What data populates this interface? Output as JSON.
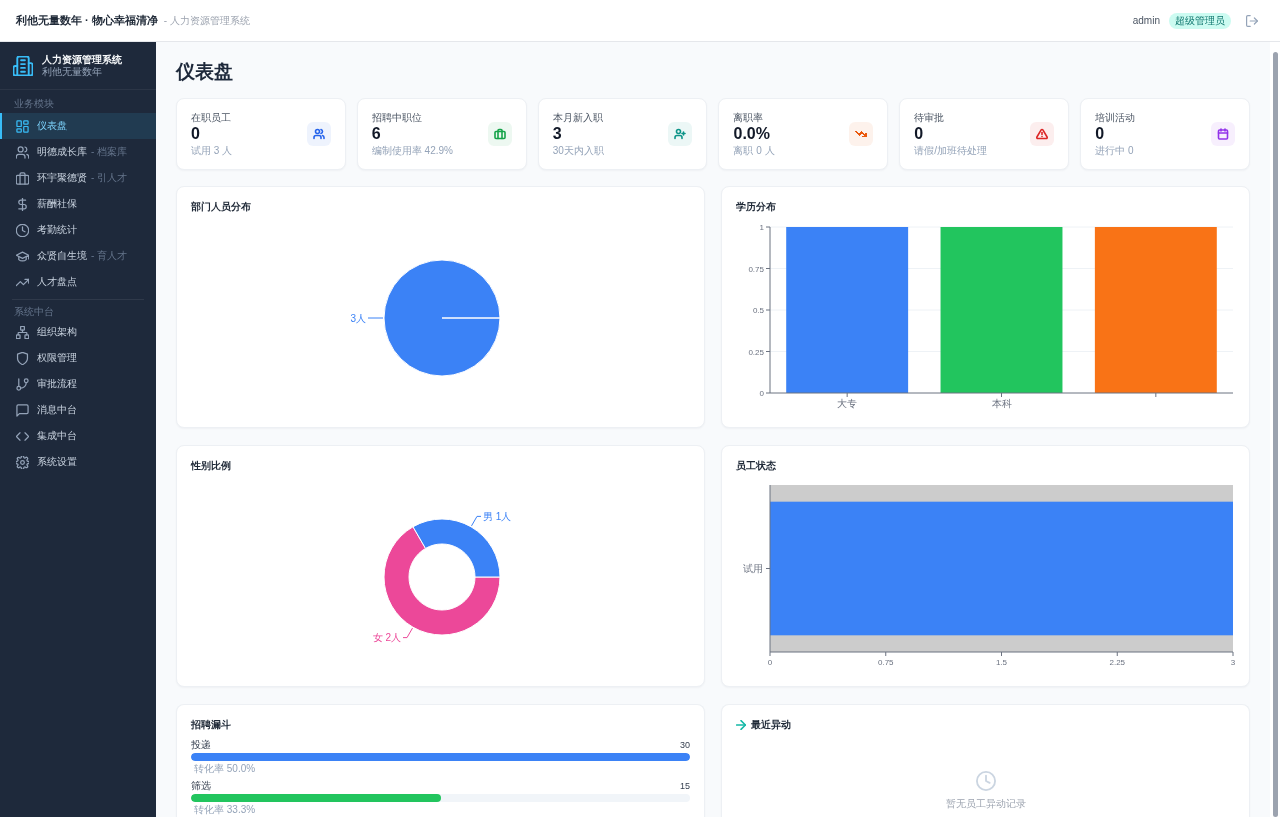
{
  "header": {
    "title": "利他无量数年 · 物心幸福清净",
    "subtitle": "- 人力资源管理系统",
    "user": "admin",
    "role": "超级管理员"
  },
  "sidebar": {
    "brand": {
      "title": "人力资源管理系统",
      "subtitle": "利他无量数年"
    },
    "sections": [
      {
        "label": "业务模块",
        "items": [
          {
            "label": "仪表盘",
            "selected": true
          },
          {
            "label": "明德成长库",
            "note": "- 档案库",
            "selected": false
          },
          {
            "label": "环宇聚德贤",
            "note": "- 引人才",
            "selected": false
          },
          {
            "label": "薪酬社保",
            "selected": false
          },
          {
            "label": "考勤统计",
            "selected": false
          },
          {
            "label": "众贤自生境",
            "note": "- 育人才",
            "selected": false
          },
          {
            "label": "人才盘点",
            "selected": false
          }
        ]
      },
      {
        "label": "系统中台",
        "items": [
          {
            "label": "组织架构",
            "selected": false
          },
          {
            "label": "权限管理",
            "selected": false
          },
          {
            "label": "审批流程",
            "selected": false
          },
          {
            "label": "消息中台",
            "selected": false
          },
          {
            "label": "集成中台",
            "selected": false
          },
          {
            "label": "系统设置",
            "selected": false
          }
        ]
      }
    ]
  },
  "page_title": "仪表盘",
  "stats": [
    {
      "label": "在职员工",
      "value": "0",
      "note": "试用 3 人",
      "color": "#2563eb"
    },
    {
      "label": "招聘中职位",
      "value": "6",
      "note": "编制使用率 42.9%",
      "color": "#16a34a"
    },
    {
      "label": "本月新入职",
      "value": "3",
      "note": "30天内入职",
      "color": "#0d9488"
    },
    {
      "label": "离职率",
      "value": "0.0%",
      "note": "离职 0 人",
      "color": "#ea580c"
    },
    {
      "label": "待审批",
      "value": "0",
      "note": "请假/加班待处理",
      "color": "#dc2626"
    },
    {
      "label": "培训活动",
      "value": "0",
      "note": "进行中 0",
      "color": "#9333ea"
    }
  ],
  "charts": [
    {
      "chart_data": {
        "type": "pie",
        "title": "部门人员分布",
        "values": [
          3
        ],
        "value_labels": [
          "3人"
        ],
        "colors": [
          "#3b82f6"
        ]
      }
    },
    {
      "chart_data": {
        "type": "bar",
        "title": "学历分布",
        "categories": [
          "大专",
          "本科",
          null
        ],
        "values": [
          1,
          1,
          1
        ],
        "colors": [
          "#3b82f6",
          "#22c55e",
          "#f97316"
        ],
        "ylim": [
          0,
          1
        ],
        "yticks": [
          0,
          0.25,
          0.5,
          0.75,
          1
        ],
        "grid": true
      }
    },
    {
      "chart_data": {
        "type": "donut",
        "title": "性别比例",
        "values": [
          2,
          1
        ],
        "value_labels": [
          "女 2人",
          "男 1人"
        ],
        "colors": [
          "#ec4899",
          "#3b82f6"
        ]
      }
    },
    {
      "chart_data": {
        "type": "bar",
        "orientation": "horizontal",
        "title": "员工状态",
        "categories": [
          "试用"
        ],
        "values": [
          3
        ],
        "colors": [
          "#3b82f6"
        ],
        "xlim": [
          0,
          3
        ],
        "xticks": [
          0,
          0.75,
          1.5,
          2.25,
          3
        ]
      }
    }
  ],
  "funnel": {
    "title": "招聘漏斗",
    "stages": [
      {
        "label": "投递",
        "count": "30",
        "level": 1.0,
        "color": "#3b82f6",
        "rate": "转化率 50.0%"
      },
      {
        "label": "筛选",
        "count": "15",
        "level": 0.5,
        "color": "#22c55e",
        "rate": "转化率 33.3%"
      }
    ]
  },
  "recent_changes": {
    "title": "最近异动",
    "empty_text": "暂无员工异动记录"
  }
}
